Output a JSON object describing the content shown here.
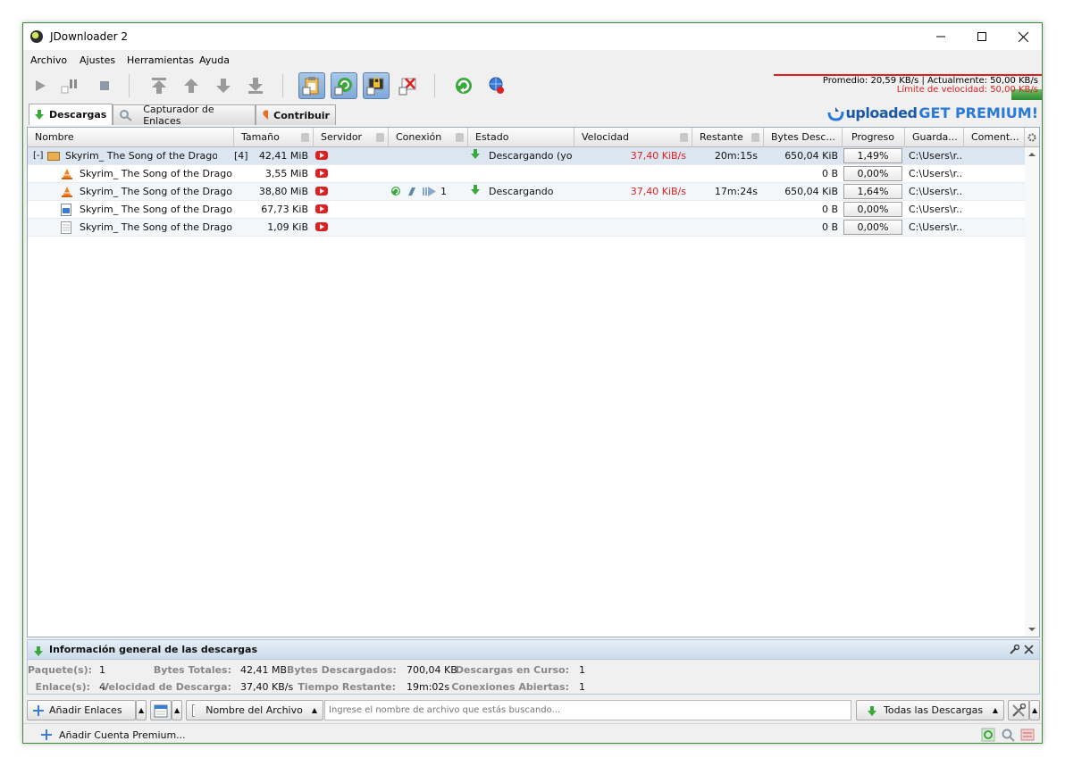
{
  "window": {
    "title": "JDownloader 2"
  },
  "menu": [
    "Archivo",
    "Ajustes",
    "Herramientas",
    "Ayuda"
  ],
  "speed": {
    "average": "Promedio: 20,59 KB/s | Actualmente: 50,00 KB/s",
    "limit": "Límite de velocidad: 50,00 KB/s"
  },
  "tabs": [
    {
      "label": "Descargas"
    },
    {
      "label": "Capturador de Enlaces"
    },
    {
      "label": "Contribuir"
    }
  ],
  "promo": {
    "brand": "uploaded",
    "cta": "GET PREMIUM!"
  },
  "columns": [
    "Nombre",
    "Tamaño",
    "Servidor",
    "Conexión",
    "Estado",
    "Velocidad",
    "Restante",
    "Bytes Desc...",
    "Progreso",
    "Guarda...",
    "Coment..."
  ],
  "package": {
    "expander": "[-]",
    "name": "Skyrim_ The Song of the Drago...",
    "count": "[4]",
    "size": "42,41 MiB",
    "status": "Descargando (yo...",
    "speed": "37,40 KiB/s",
    "remaining": "20m:15s",
    "bytes": "650,04 KiB",
    "progress": "1,49%",
    "saveto": "C:\\Users\\r..."
  },
  "files": [
    {
      "name": "Skyrim_ The Song of the Dragonbo.",
      "size": "3,55 MiB",
      "icon": "vlc-cone-icon",
      "connection": "",
      "status": "",
      "speed": "",
      "remaining": "",
      "bytes": "0 B",
      "progress": "0,00%",
      "saveto": "C:\\Users\\r..."
    },
    {
      "name": "Skyrim_ The Song of the Dragonbo.",
      "size": "38,80 MiB",
      "icon": "vlc-cone-icon",
      "connection": "1",
      "status": "Descargando",
      "speed": "37,40 KiB/s",
      "remaining": "17m:24s",
      "bytes": "650,04 KiB",
      "progress": "1,64%",
      "saveto": "C:\\Users\\r..."
    },
    {
      "name": "Skyrim_ The Song of the Dragonbo.",
      "size": "67,73 KiB",
      "icon": "image-file-icon",
      "connection": "",
      "status": "",
      "speed": "",
      "remaining": "",
      "bytes": "0 B",
      "progress": "0,00%",
      "saveto": "C:\\Users\\r..."
    },
    {
      "name": "Skyrim_ The Song of the Dragonbo.",
      "size": "1,09 KiB",
      "icon": "text-file-icon",
      "connection": "",
      "status": "",
      "speed": "",
      "remaining": "",
      "bytes": "0 B",
      "progress": "0,00%",
      "saveto": "C:\\Users\\r..."
    }
  ],
  "info": {
    "title": "Información general de las descargas",
    "paquetes_label": "Paquete(s):",
    "paquetes": "1",
    "enlaces_label": "Enlace(s):",
    "enlaces": "4",
    "bytes_totales_label": "Bytes Totales:",
    "bytes_totales": "42,41 MB",
    "velocidad_label": "Velocidad de Descarga:",
    "velocidad": "37,40 KB/s",
    "bytes_desc_label": "Bytes Descargados:",
    "bytes_desc": "700,04 KB",
    "tiempo_label": "Tiempo Restante:",
    "tiempo": "19m:02s",
    "en_curso_label": "Descargas en Curso:",
    "en_curso": "1",
    "conexiones_label": "Conexiones Abiertas:",
    "conexiones": "1"
  },
  "bottom": {
    "add_links": "Añadir Enlaces",
    "filename_select": "Nombre del Archivo",
    "search_placeholder": "Ingrese el nombre de archivo que estás buscando...",
    "filter": "Todas las Descargas"
  },
  "status": {
    "add_premium": "Añadir Cuenta Premium..."
  },
  "colors": {
    "accent": "#3c8a3c",
    "error": "#e02020",
    "selection": "#dbe6f0"
  }
}
